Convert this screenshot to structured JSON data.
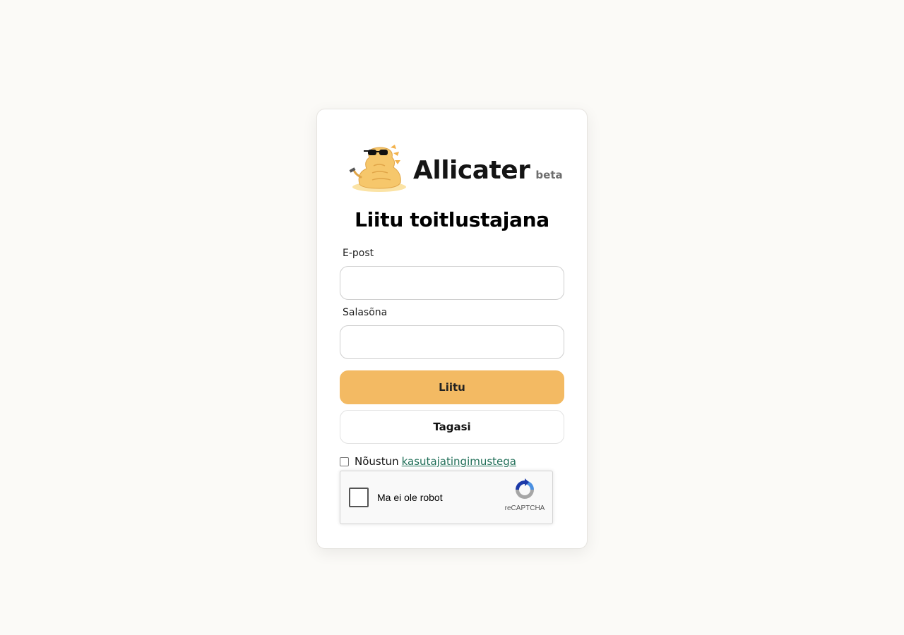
{
  "brand": {
    "name": "Allicater",
    "badge": "beta",
    "logo_icon": "alligator-mascot-icon"
  },
  "form": {
    "title": "Liitu toitlustajana",
    "email_label": "E-post",
    "email_value": "",
    "password_label": "Salasõna",
    "password_value": "",
    "submit_label": "Liitu",
    "back_label": "Tagasi",
    "terms_prefix": "Nõustun",
    "terms_link": "kasutajatingimustega",
    "terms_checked": false
  },
  "recaptcha": {
    "label": "Ma ei ole robot",
    "brand": "reCAPTCHA",
    "icon": "recaptcha-logo-icon"
  },
  "colors": {
    "primary": "#f3ba63",
    "link": "#1f6e57",
    "background": "#fbfaf7"
  }
}
